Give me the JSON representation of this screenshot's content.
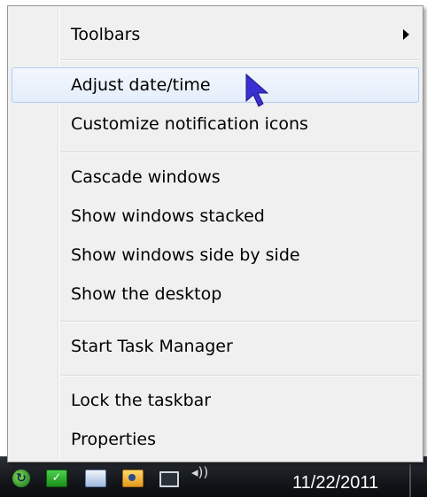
{
  "menu": {
    "items": [
      {
        "label": "Toolbars",
        "has_submenu": true,
        "hovered": false
      },
      {
        "label": "Adjust date/time",
        "has_submenu": false,
        "hovered": true
      },
      {
        "label": "Customize notification icons",
        "has_submenu": false,
        "hovered": false
      },
      {
        "label": "Cascade windows",
        "has_submenu": false,
        "hovered": false
      },
      {
        "label": "Show windows stacked",
        "has_submenu": false,
        "hovered": false
      },
      {
        "label": "Show windows side by side",
        "has_submenu": false,
        "hovered": false
      },
      {
        "label": "Show the desktop",
        "has_submenu": false,
        "hovered": false
      },
      {
        "label": "Start Task Manager",
        "has_submenu": false,
        "hovered": false
      },
      {
        "label": "Lock the taskbar",
        "has_submenu": false,
        "hovered": false
      },
      {
        "label": "Properties",
        "has_submenu": false,
        "hovered": false
      }
    ]
  },
  "taskbar": {
    "clock_date": "11/22/2011",
    "tray_icons": [
      "sync-icon",
      "checkmark-icon",
      "flag-icon",
      "folder-icon",
      "network-icon",
      "volume-icon"
    ]
  },
  "colors": {
    "menu_background": "#f0f0f0",
    "hover_border": "#aecff7",
    "cursor_accent": "#3a2fd0",
    "taskbar": "#15181c"
  }
}
